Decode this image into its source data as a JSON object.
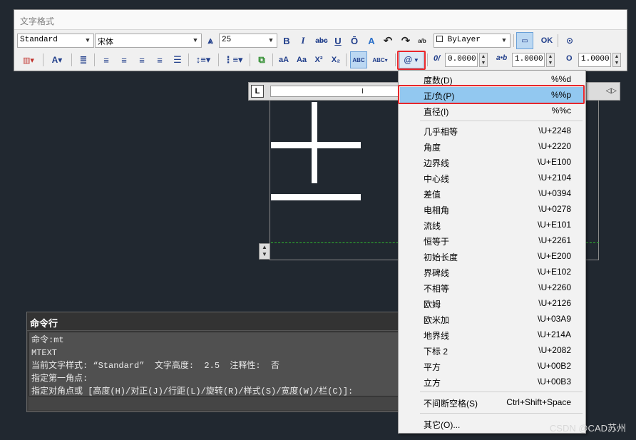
{
  "window": {
    "title": "文字格式"
  },
  "toolbar1": {
    "style_combo": "Standard",
    "font_combo": "宋体",
    "height_combo": "25",
    "bold_label": "B",
    "italic_label": "I",
    "strike_label": "abc",
    "underline_label": "U",
    "overline_label": "Ō",
    "stack_label": "a/b",
    "color_combo": "ByLayer",
    "ok_label": "OK"
  },
  "toolbar2": {
    "oblique_label": "0/",
    "oblique_value": "0.0000",
    "tracking_label": "a•b",
    "tracking_value": "1.0000",
    "width_label": "O",
    "width_value": "1.0000",
    "case_upper": "aA",
    "case_lower": "Aa",
    "superscript": "X²",
    "subscript": "X₂",
    "symbol_label": "@"
  },
  "symbol_menu": {
    "items": [
      {
        "label": "度数(D)",
        "code": "%%d"
      },
      {
        "label": "正/负(P)",
        "code": "%%p"
      },
      {
        "label": "直径(I)",
        "code": "%%c"
      },
      {
        "label": "几乎相等",
        "code": "\\U+2248"
      },
      {
        "label": "角度",
        "code": "\\U+2220"
      },
      {
        "label": "边界线",
        "code": "\\U+E100"
      },
      {
        "label": "中心线",
        "code": "\\U+2104"
      },
      {
        "label": "差值",
        "code": "\\U+0394"
      },
      {
        "label": "电相角",
        "code": "\\U+0278"
      },
      {
        "label": "流线",
        "code": "\\U+E101"
      },
      {
        "label": "恒等于",
        "code": "\\U+2261"
      },
      {
        "label": "初始长度",
        "code": "\\U+E200"
      },
      {
        "label": "界碑线",
        "code": "\\U+E102"
      },
      {
        "label": "不相等",
        "code": "\\U+2260"
      },
      {
        "label": "欧姆",
        "code": "\\U+2126"
      },
      {
        "label": "欧米加",
        "code": "\\U+03A9"
      },
      {
        "label": "地界线",
        "code": "\\U+214A"
      },
      {
        "label": "下标 2",
        "code": "\\U+2082"
      },
      {
        "label": "平方",
        "code": "\\U+00B2"
      },
      {
        "label": "立方",
        "code": "\\U+00B3"
      },
      {
        "label": "不间断空格(S)",
        "code": "Ctrl+Shift+Space"
      },
      {
        "label": "其它(O)...",
        "code": ""
      }
    ],
    "selected_index": 1
  },
  "command_line": {
    "title": "命令行",
    "lines": [
      "命令:mt",
      "MTEXT",
      "当前文字样式: “Standard”  文字高度:  2.5  注释性:  否",
      "指定第一角点:",
      "指定对角点或 [高度(H)/对正(J)/行距(L)/旋转(R)/样式(S)/宽度(W)/栏(C)]:"
    ]
  },
  "ruler": {
    "tab_label": "L",
    "right_label": "◁▷"
  },
  "watermark": "CSDN @CAD苏州",
  "colors": {
    "highlight_red": "#e8262b",
    "selected_blue": "#92c8f0",
    "canvas_bg": "#212830"
  }
}
